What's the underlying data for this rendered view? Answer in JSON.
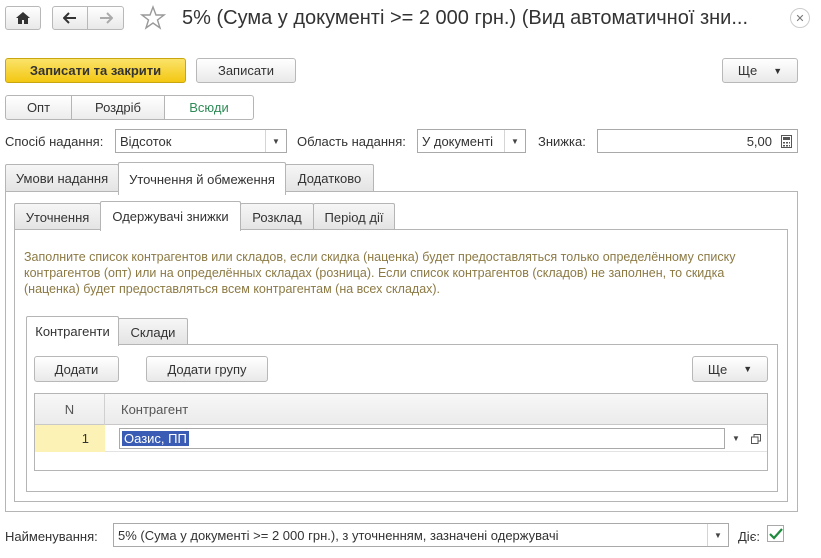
{
  "window": {
    "title": "5% (Сума у документі >= 2 000 грн.) (Вид автоматичної зни..."
  },
  "toolbar": {
    "save_close_label": "Записати та закрити",
    "save_label": "Записати",
    "more_label": "Ще"
  },
  "segments": [
    {
      "label": "Опт",
      "active": false
    },
    {
      "label": "Роздріб",
      "active": false
    },
    {
      "label": "Всюди",
      "active": true
    }
  ],
  "fields": {
    "method_label": "Спосіб надання:",
    "method_value": "Відсоток",
    "area_label": "Область надання:",
    "area_value": "У документі",
    "discount_label": "Знижка:",
    "discount_value": "5,00"
  },
  "tabs": {
    "main": [
      "Умови надання",
      "Уточнення й обмеження",
      "Додатково"
    ],
    "sub": [
      "Уточнення",
      "Одержувачі знижки",
      "Розклад",
      "Період дії"
    ],
    "inner": [
      "Контрагенти",
      "Склади"
    ]
  },
  "info_text": "Заполните список контрагентов или складов, если скидка (наценка) будет предоставляться только определённому списку контрагентов (опт) или на определённых складах (розница). Если список контрагентов (складов) не заполнен, то скидка (наценка) будет предоставляться всем контрагентам (на всех складах).",
  "inner_toolbar": {
    "add_label": "Додати",
    "add_group_label": "Додати групу",
    "more_label": "Ще"
  },
  "table": {
    "columns": [
      "N",
      "Контрагент"
    ],
    "rows": [
      {
        "n": "1",
        "counterparty": "Оазис, ПП"
      }
    ]
  },
  "footer": {
    "name_label": "Найменування:",
    "name_value": "5% (Сума у документі >= 2 000 грн.), з уточненням, зазначені одержувачі",
    "active_label": "Діє:",
    "active_checked": true
  },
  "colors": {
    "primary_button": "#f3c712",
    "active_segment_text": "#2e8b57",
    "info_text": "#8c7a44",
    "selected_cell": "#fdf2b5",
    "selection_highlight": "#3a5cb5",
    "check_color": "#1e8a3c"
  }
}
